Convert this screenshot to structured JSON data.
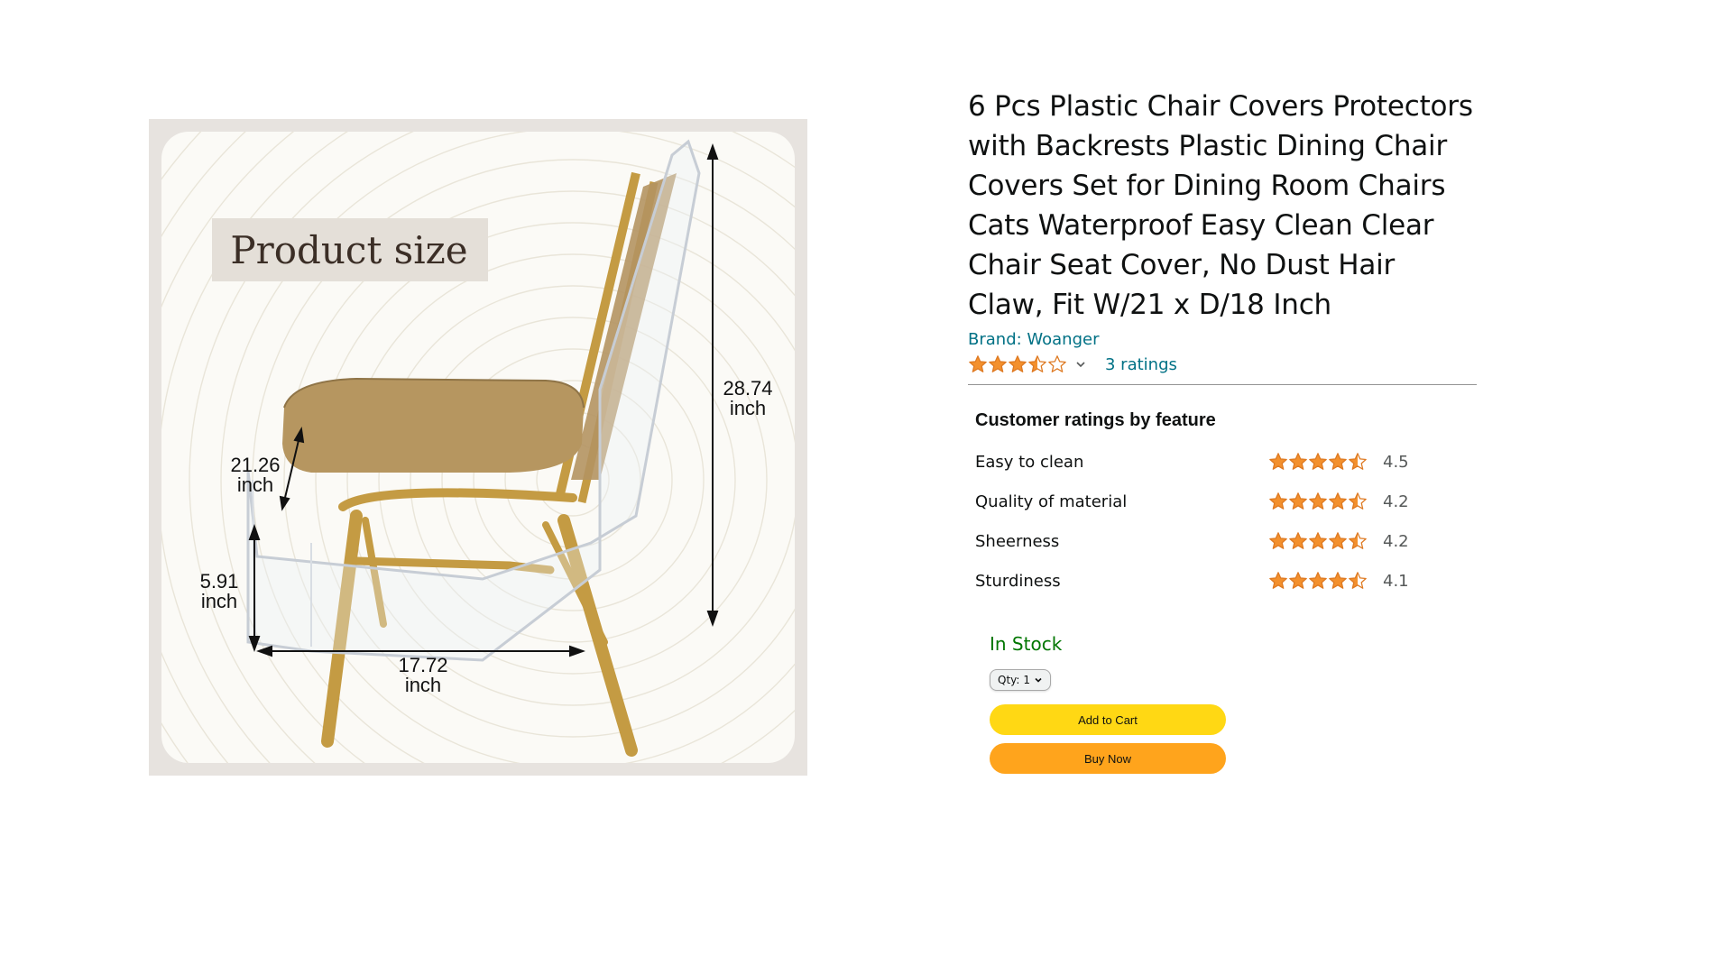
{
  "image": {
    "badge_text": "Product size",
    "dimensions": {
      "height": {
        "value": "28.74",
        "unit": "inch"
      },
      "depth": {
        "value": "21.26",
        "unit": "inch"
      },
      "seat_height": {
        "value": "5.91",
        "unit": "inch"
      },
      "width": {
        "value": "17.72",
        "unit": "inch"
      }
    }
  },
  "product": {
    "title": "6 Pcs Plastic Chair Covers Protectors with Backrests Plastic Dining Chair Covers Set for Dining Room Chairs Cats Waterproof Easy Clean Clear Chair Seat Cover, No Dust Hair Claw, Fit W/21 x D/18 Inch",
    "brand": "Brand: Woanger",
    "rating_stars": 3.5,
    "ratings_count": "3 ratings"
  },
  "feature_ratings": {
    "heading": "Customer ratings by feature",
    "items": [
      {
        "name": "Easy to clean",
        "score": "4.5",
        "stars": 4.5
      },
      {
        "name": "Quality of material",
        "score": "4.2",
        "stars": 4.5
      },
      {
        "name": "Sheerness",
        "score": "4.2",
        "stars": 4.5
      },
      {
        "name": "Sturdiness",
        "score": "4.1",
        "stars": 4.5
      }
    ]
  },
  "buybox": {
    "stock": "In Stock",
    "qty_label": "Qty:",
    "qty_value": "1",
    "add_to_cart": "Add to Cart",
    "buy_now": "Buy Now"
  },
  "colors": {
    "link": "#007185",
    "star": "#f3902d",
    "in_stock": "#007600",
    "add_to_cart_bg": "#ffd814",
    "buy_now_bg": "#ffa41c"
  },
  "icons": {
    "star_full": "star-full-icon",
    "star_half": "star-half-icon",
    "star_empty": "star-empty-icon",
    "chevron": "chevron-down-icon"
  }
}
